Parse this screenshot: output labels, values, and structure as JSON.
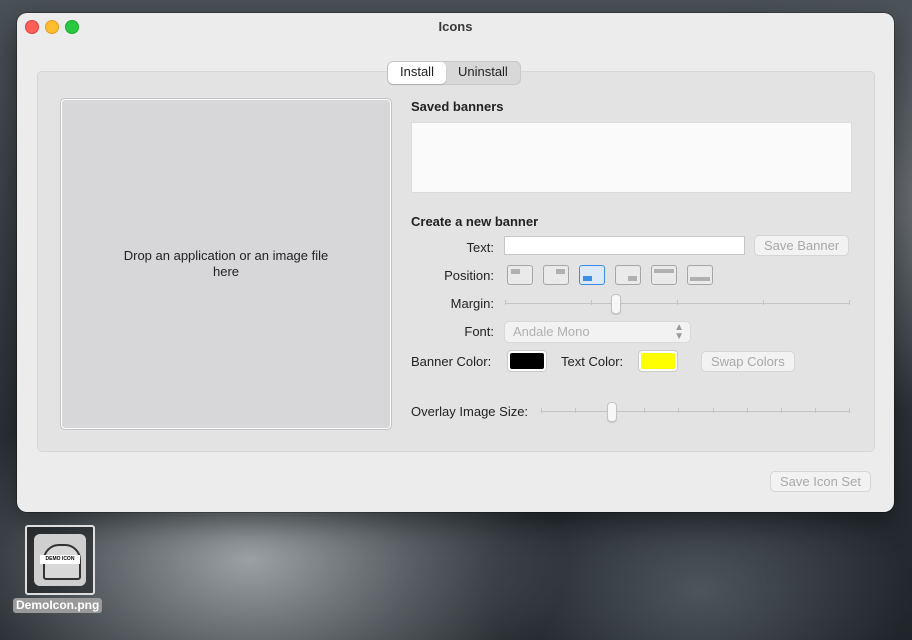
{
  "window": {
    "title": "Icons"
  },
  "tabs": [
    {
      "label": "Install",
      "active": true
    },
    {
      "label": "Uninstall",
      "active": false
    }
  ],
  "drop_area": {
    "label": "Drop an application or an image file here"
  },
  "saved_banners": {
    "heading": "Saved banners",
    "items": []
  },
  "create_banner": {
    "heading": "Create a new banner",
    "text_label": "Text:",
    "text_value": "",
    "save_banner_label": "Save Banner",
    "position_label": "Position:",
    "position_options": [
      "top-left",
      "top-right",
      "bottom-left",
      "bottom-right",
      "top",
      "bottom"
    ],
    "position_selected": "bottom-left",
    "margin_label": "Margin:",
    "margin_value": 0.32,
    "font_label": "Font:",
    "font_value": "Andale Mono",
    "banner_color_label": "Banner Color:",
    "banner_color": "#000000",
    "text_color_label": "Text Color:",
    "text_color": "#ffff00",
    "swap_colors_label": "Swap Colors",
    "overlay_size_label": "Overlay Image Size:",
    "overlay_size_value": 0.23
  },
  "footer": {
    "save_icon_set_label": "Save Icon Set"
  },
  "desktop": {
    "file_label": "DemoIcon.png",
    "file_banner_text": "DEMO ICON"
  }
}
